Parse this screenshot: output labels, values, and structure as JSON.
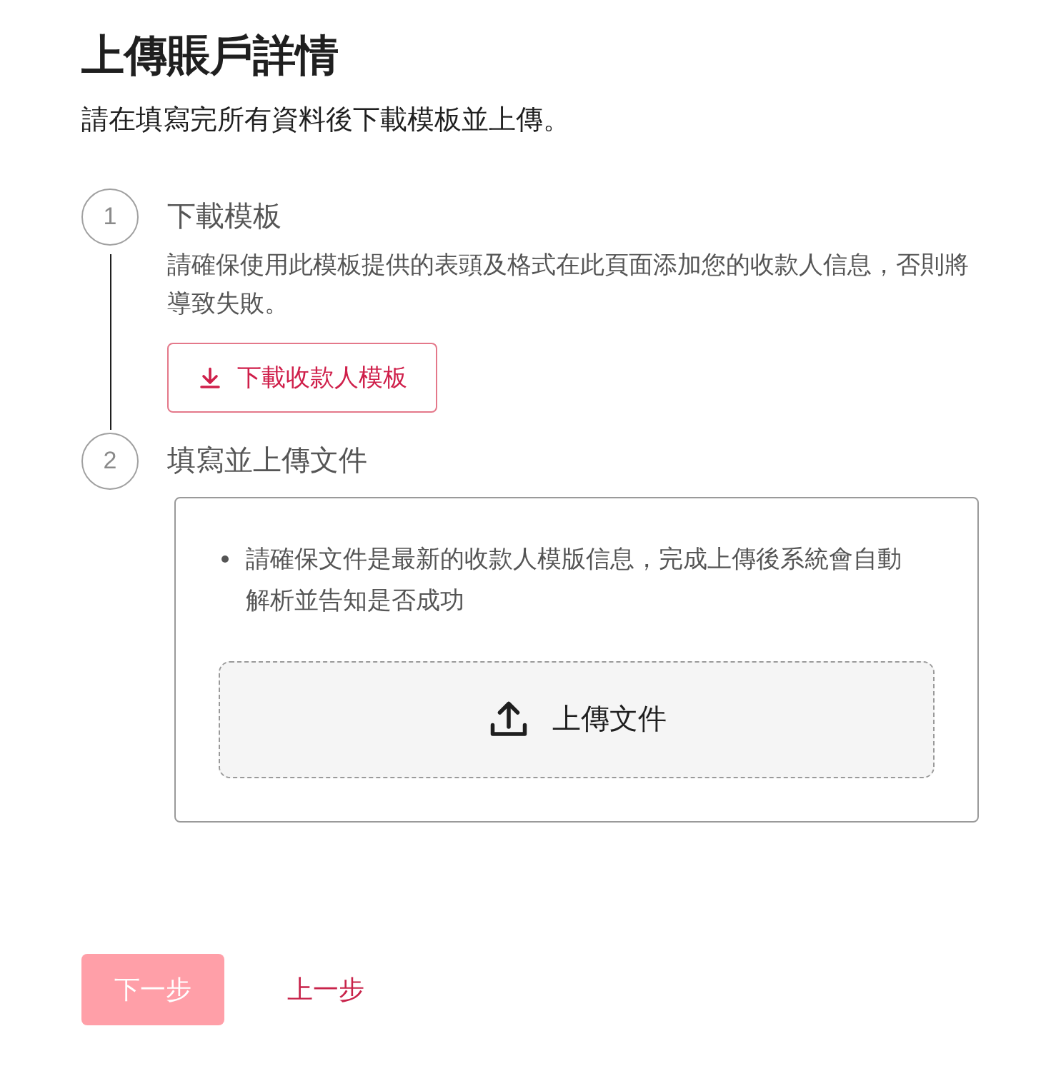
{
  "title": "上傳賬戶詳情",
  "subtitle": "請在填寫完所有資料後下載模板並上傳。",
  "steps": [
    {
      "number": "1",
      "title": "下載模板",
      "kind": "download",
      "description": "請確保使用此模板提供的表頭及格式在此頁面添加您的收款人信息，否則將導致失敗。",
      "button": "下載收款人模板"
    },
    {
      "number": "2",
      "title": "填寫並上傳文件",
      "kind": "upload",
      "notes": [
        "請確保文件是最新的收款人模版信息，完成上傳後系統會自動解析並告知是否成功"
      ],
      "dropzone": "上傳文件"
    }
  ],
  "footer": {
    "next": {
      "label": "下一步",
      "disabled": true
    },
    "back": {
      "label": "上一步"
    }
  }
}
